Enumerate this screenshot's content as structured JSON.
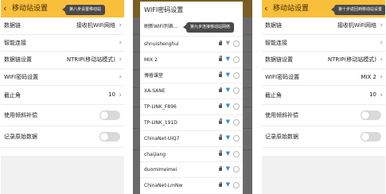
{
  "panel1": {
    "header": {
      "back_icon": "chevron-left-icon",
      "title": "移动站设置",
      "tooltip": "第八步设置移动站"
    },
    "rows": [
      {
        "label": "数据链",
        "value": "接收机WiFi网络",
        "chevron": "›"
      },
      {
        "label": "智能连接",
        "value": "",
        "chevron": "›"
      },
      {
        "label": "数据链设置",
        "value": "NTRIP(移动站模式)",
        "chevron": "›"
      },
      {
        "label": "WIFI密码设置",
        "value": "",
        "chevron": "›"
      },
      {
        "label": "截止角",
        "value": "10",
        "chevron": "›"
      },
      {
        "label": "使用倾斜补偿",
        "toggle": false
      },
      {
        "label": "记录原始数据",
        "toggle": false
      }
    ]
  },
  "panel2": {
    "dialog": {
      "title": "WIFI密码设置",
      "refresh_label": "刷新WIFI列表...",
      "tooltip": "第九步连接移动站网络",
      "networks": [
        {
          "ssid": "shnuishenghui",
          "locked": true,
          "wifi_color": "#999999"
        },
        {
          "ssid": "MIX 2",
          "locked": true,
          "wifi_color": "#2a8fd6"
        },
        {
          "ssid": "博睿课堂",
          "locked": true,
          "wifi_color": "#2a8fd6"
        },
        {
          "ssid": "XA-SANE",
          "locked": true,
          "wifi_color": "#2a8fd6"
        },
        {
          "ssid": "TP-LINK_F896",
          "locked": true,
          "wifi_color": "#2a8fd6"
        },
        {
          "ssid": "TP-LINK_191D",
          "locked": true,
          "wifi_color": "#2a8fd6"
        },
        {
          "ssid": "ChinaNet-UiQ7",
          "locked": true,
          "wifi_color": "#2a8fd6"
        },
        {
          "ssid": "chaijiang",
          "locked": true,
          "wifi_color": "#2a8fd6"
        },
        {
          "ssid": "duomimeimei",
          "locked": true,
          "wifi_color": "#2a8fd6"
        },
        {
          "ssid": "ChinaNet-LmNw",
          "locked": true,
          "wifi_color": "#2a8fd6"
        }
      ]
    }
  },
  "panel3": {
    "header": {
      "back_icon": "chevron-left-icon",
      "title": "移动站设置",
      "tooltip": "第十步返回到移动站设置"
    },
    "rows": [
      {
        "label": "数据链",
        "value": "接收机WiFi网络",
        "chevron": "›"
      },
      {
        "label": "智能连接",
        "value": "",
        "chevron": "›"
      },
      {
        "label": "数据链设置",
        "value": "NTRIP(移动站模式)",
        "chevron": "›"
      },
      {
        "label": "WIFI密码设置",
        "value": "MIX 2",
        "chevron": "›"
      },
      {
        "label": "截止角",
        "value": "10",
        "chevron": "›"
      },
      {
        "label": "使用倾斜补偿",
        "toggle": false
      },
      {
        "label": "记录原始数据",
        "toggle": false
      }
    ]
  },
  "colors": {
    "header_accent": "#f9bf3b",
    "wifi_connected": "#2a8fd6"
  }
}
